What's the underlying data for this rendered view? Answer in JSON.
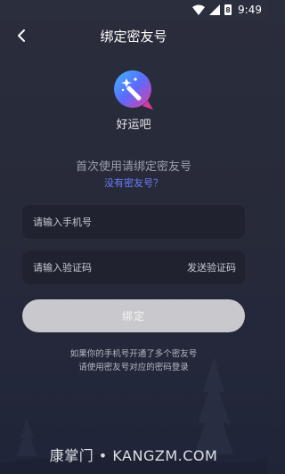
{
  "status_bar": {
    "time": "9:49",
    "battery_badge": "8"
  },
  "nav": {
    "title": "绑定密友号"
  },
  "app": {
    "name": "好运吧"
  },
  "prompt": {
    "text": "首次使用请绑定密友号",
    "help_link": "没有密友号？"
  },
  "form": {
    "phone_placeholder": "请输入手机号",
    "code_placeholder": "请输入验证码",
    "send_code_label": "发送验证码",
    "submit_label": "绑定"
  },
  "notes": {
    "line1": "如果你的手机号开通了多个密友号",
    "line2": "请使用密友号对应的密码登录"
  },
  "watermark": "康掌门 • KANGZM.COM",
  "colors": {
    "background": "#272a39",
    "link": "#6c7dff",
    "button": "#c9c9cd",
    "field": "#20232f"
  },
  "icons": [
    "wifi-icon",
    "signal-icon",
    "battery-icon",
    "back-arrow-icon",
    "app-logo-magic-wand-icon"
  ]
}
